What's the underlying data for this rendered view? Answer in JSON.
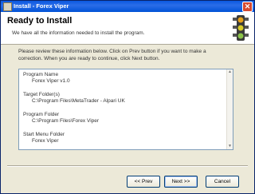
{
  "window": {
    "title": "Install - Forex Viper",
    "close_glyph": "✕"
  },
  "header": {
    "heading": "Ready to Install",
    "subheading": "We have all the information needed to install the program.",
    "icon": "traffic-light-icon"
  },
  "body": {
    "instructions_line1": "Please review these information below. Click on Prev button if you want to make a",
    "instructions_line2": "correction. When you are ready to continue, click Next button."
  },
  "summary": {
    "program_name_label": "Program Name",
    "program_name_value": "Forex Viper v1.0",
    "target_folders_label": "Target Folder(s)",
    "target_folders_value": "C:\\Program Files\\MetaTrader - Alpari UK",
    "program_folder_label": "Program Folder",
    "program_folder_value": "C:\\Program Files\\Forex Viper",
    "start_menu_label": "Start Menu Folder",
    "start_menu_value": "Forex Viper"
  },
  "buttons": {
    "prev": "<< Prev",
    "next": "Next >>",
    "cancel": "Cancel"
  }
}
